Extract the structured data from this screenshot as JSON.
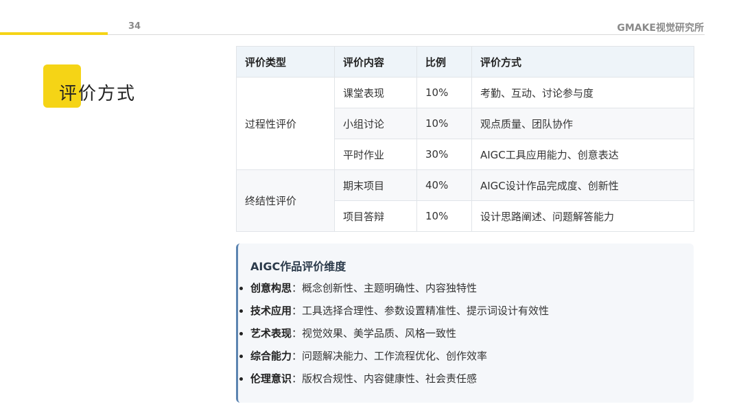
{
  "header": {
    "page_number": "34",
    "brand": "GMAKE视觉研究所"
  },
  "page_title": "评价方式",
  "table": {
    "columns": [
      "评价类型",
      "评价内容",
      "比例",
      "评价方式"
    ],
    "groups": [
      {
        "type": "过程性评价",
        "rows": [
          {
            "content": "课堂表现",
            "ratio": "10%",
            "method": "考勤、互动、讨论参与度"
          },
          {
            "content": "小组讨论",
            "ratio": "10%",
            "method": "观点质量、团队协作"
          },
          {
            "content": "平时作业",
            "ratio": "30%",
            "method": "AIGC工具应用能力、创意表达"
          }
        ]
      },
      {
        "type": "终结性评价",
        "rows": [
          {
            "content": "期末项目",
            "ratio": "40%",
            "method": "AIGC设计作品完成度、创新性"
          },
          {
            "content": "项目答辩",
            "ratio": "10%",
            "method": "设计思路阐述、问题解答能力"
          }
        ]
      }
    ]
  },
  "dimensions": {
    "heading": "AIGC作品评价维度",
    "items": [
      {
        "term": "创意构思",
        "desc": "：概念创新性、主题明确性、内容独特性"
      },
      {
        "term": "技术应用",
        "desc": "：工具选择合理性、参数设置精准性、提示词设计有效性"
      },
      {
        "term": "艺术表现",
        "desc": "：视觉效果、美学品质、风格一致性"
      },
      {
        "term": "综合能力",
        "desc": "：问题解决能力、工作流程优化、创作效率"
      },
      {
        "term": "伦理意识",
        "desc": "：版权合规性、内容健康性、社会责任感"
      }
    ]
  },
  "colors": {
    "accent": "#f5d416",
    "table_header_bg": "#eef4f9",
    "box_border": "#5b84b1",
    "box_bg": "#f5f7fa"
  }
}
